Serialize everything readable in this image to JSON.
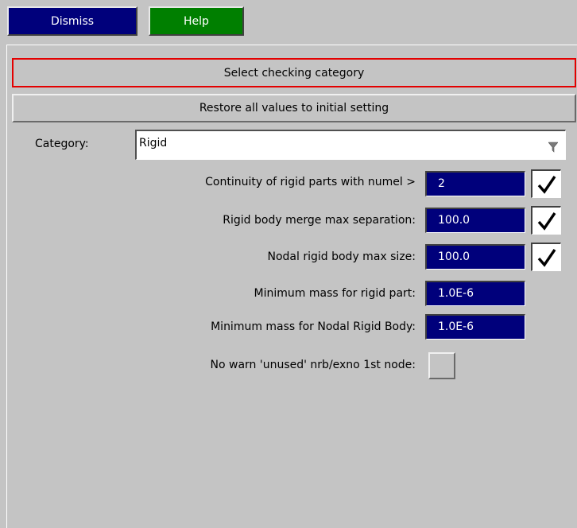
{
  "top_buttons": {
    "dismiss": "Dismiss",
    "help": "Help"
  },
  "header": {
    "select_category": "Select checking category",
    "restore": "Restore all values to initial setting"
  },
  "category": {
    "label": "Category:",
    "value": "Rigid"
  },
  "rows": [
    {
      "label": "Continuity of rigid parts with numel >",
      "value": "2",
      "checked": true
    },
    {
      "label": "Rigid body merge max separation:",
      "value": "100.0",
      "checked": true
    },
    {
      "label": "Nodal rigid body max size:",
      "value": "100.0",
      "checked": true
    },
    {
      "label": "Minimum mass for rigid part:",
      "value": "1.0E-6"
    },
    {
      "label": "Minimum mass for Nodal Rigid Body:",
      "value": "1.0E-6"
    },
    {
      "label": "No warn 'unused' nrb/exno 1st node:",
      "toggle": false
    }
  ],
  "colors": {
    "dismiss_bg": "#00007b",
    "help_bg": "#007f00",
    "field_bg": "#00007b",
    "highlight_border": "#e40000",
    "panel_bg": "#c4c4c4"
  },
  "icons": {
    "dropdown": "filter-funnel-icon",
    "check": "checkmark-icon"
  }
}
